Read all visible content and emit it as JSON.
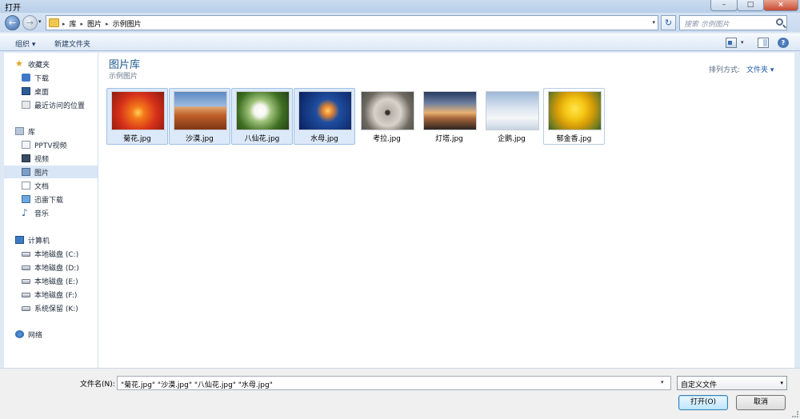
{
  "window": {
    "title": "打开",
    "close": "×",
    "minimize": "–",
    "maximize": "□"
  },
  "nav": {
    "back": "←",
    "forward": "→",
    "dropdown": "▾"
  },
  "address": {
    "crumbs": [
      "库",
      "图片",
      "示例图片"
    ],
    "separator": "▸",
    "dropdown": "▾",
    "refresh": "↻"
  },
  "search": {
    "placeholder": "搜索 示例图片"
  },
  "toolbar": {
    "organize": "组织 ▾",
    "new_folder": "新建文件夹",
    "view_dropdown": "▾",
    "help": "?"
  },
  "sidebar": {
    "favorites": {
      "label": "收藏夹",
      "items": [
        "下载",
        "桌面",
        "最近访问的位置"
      ]
    },
    "libraries": {
      "label": "库",
      "items": [
        "PPTV视频",
        "视频",
        "图片",
        "文档",
        "迅雷下载",
        "音乐"
      ],
      "selected": "图片"
    },
    "computer": {
      "label": "计算机",
      "items": [
        "本地磁盘 (C:)",
        "本地磁盘 (D:)",
        "本地磁盘 (E:)",
        "本地磁盘 (F:)",
        "系统保留 (K:)"
      ]
    },
    "network": {
      "label": "网络"
    }
  },
  "content": {
    "title": "图片库",
    "subtitle": "示例图片",
    "arrange_label": "排列方式:",
    "arrange_value": "文件夹 ▾",
    "files": [
      {
        "name": "菊花.jpg",
        "selected": true
      },
      {
        "name": "沙漠.jpg",
        "selected": true
      },
      {
        "name": "八仙花.jpg",
        "selected": true
      },
      {
        "name": "水母.jpg",
        "selected": true
      },
      {
        "name": "考拉.jpg",
        "selected": false
      },
      {
        "name": "灯塔.jpg",
        "selected": false
      },
      {
        "name": "企鹅.jpg",
        "selected": false
      },
      {
        "name": "郁金香.jpg",
        "selected": false
      }
    ]
  },
  "footer": {
    "filename_label": "文件名(N):",
    "filename_value": "\"菊花.jpg\" \"沙漠.jpg\" \"八仙花.jpg\" \"水母.jpg\"",
    "filter_value": "自定义文件",
    "dropdown": "▾",
    "open": "打开(O)",
    "cancel": "取消"
  }
}
